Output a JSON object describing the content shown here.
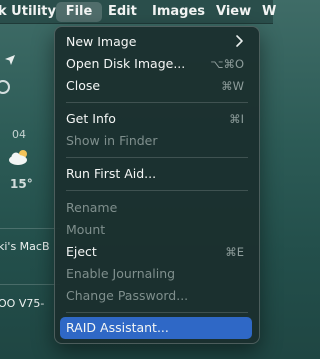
{
  "menubar": {
    "app": "k Utility",
    "file": "File",
    "edit": "Edit",
    "images": "Images",
    "view": "View",
    "window": "W"
  },
  "background": {
    "weather_day": "04",
    "weather_temp": "15°",
    "disk_1": "ki's MacB",
    "disk_2": "OO V75-",
    "icons": [
      "location-arrow-icon",
      "ring-icon",
      "cloud-sun-icon"
    ]
  },
  "file_menu": {
    "items": [
      {
        "label": "New Image",
        "shortcut": "",
        "submenu": true,
        "enabled": true
      },
      {
        "label": "Open Disk Image...",
        "shortcut": "⌥⌘O",
        "enabled": true
      },
      {
        "label": "Close",
        "shortcut": "⌘W",
        "enabled": true
      },
      {
        "label": "Get Info",
        "shortcut": "⌘I",
        "enabled": true
      },
      {
        "label": "Show in Finder",
        "shortcut": "",
        "enabled": false
      },
      {
        "label": "Run First Aid...",
        "shortcut": "",
        "enabled": true
      },
      {
        "label": "Rename",
        "shortcut": "",
        "enabled": false
      },
      {
        "label": "Mount",
        "shortcut": "",
        "enabled": false
      },
      {
        "label": "Eject",
        "shortcut": "⌘E",
        "enabled": true
      },
      {
        "label": "Enable Journaling",
        "shortcut": "",
        "enabled": false
      },
      {
        "label": "Change Password...",
        "shortcut": "",
        "enabled": false
      },
      {
        "label": "RAID Assistant...",
        "shortcut": "",
        "enabled": true,
        "highlighted": true
      }
    ]
  },
  "colors": {
    "highlight": "#2f68c6",
    "menu_bg": "#1b2f2e",
    "desktop": "#2c5b56"
  }
}
